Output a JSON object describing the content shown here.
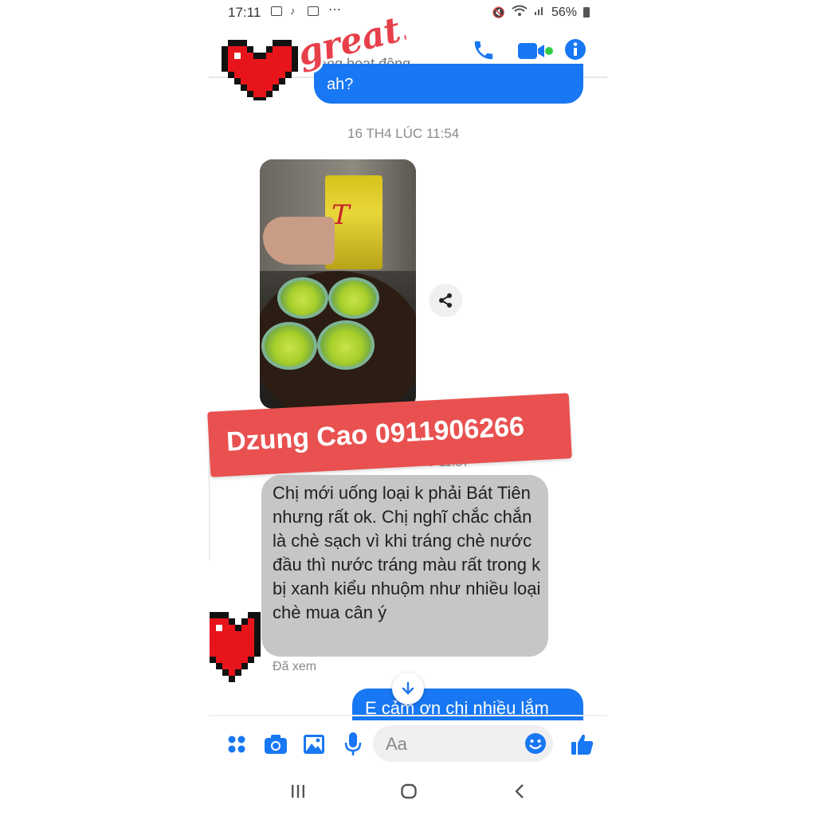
{
  "status_bar": {
    "time": "17:11",
    "battery": "56%"
  },
  "header": {
    "active_status": "ang hoạt động"
  },
  "messages": {
    "prev_outgoing": "ah?",
    "timestamp_1": "16 TH4 LÚC 11:54",
    "timestamp_2": "LÚC 11:57",
    "incoming_text": "Chị mới uống loại k phải Bát Tiên nhưng rất ok. Chị nghĩ chắc chắn là chè sạch vì khi tráng chè nước đầu thì nước tráng màu rất trong k bị xanh kiểu nhuộm như nhiều loại chè mua cân ý",
    "seen": "Đã xem",
    "last_outgoing": "E cảm ơn chị nhiều lắm"
  },
  "overlay": {
    "banner": "Dzung Cao 0911906266",
    "sticker_text": "great!"
  },
  "composer": {
    "placeholder": "Aa"
  },
  "colors": {
    "accent": "#1877f2",
    "banner": "#e85150",
    "incoming_bubble": "#c6c6c6"
  }
}
